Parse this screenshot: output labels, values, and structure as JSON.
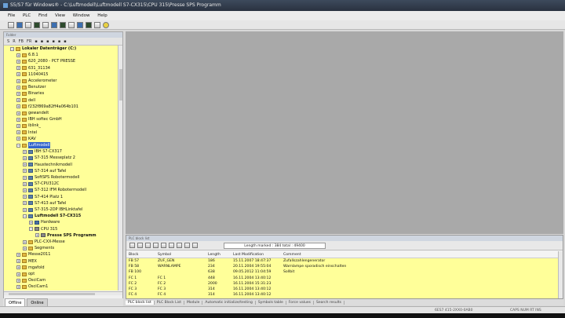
{
  "window": {
    "title": "S5/S7 für Windows® - C:\\Luftmodell\\Luftmodell S7-CX315\\CPU 315\\Presse SPS Programm"
  },
  "menu": [
    "File",
    "PLC",
    "Find",
    "View",
    "Window",
    "Help"
  ],
  "tree": {
    "caption": "Folder",
    "toolbar": [
      "S",
      "R",
      "FB",
      "FR",
      "",
      "",
      "",
      "",
      "",
      "",
      ""
    ],
    "nodes": [
      {
        "label": "Lokaler Datenträger (C:)",
        "bold": true
      },
      {
        "label": "6.8.1"
      },
      {
        "label": "620_2080 - PCT PRESSE"
      },
      {
        "label": "631_31134"
      },
      {
        "label": "11040415"
      },
      {
        "label": "Accelerometer"
      },
      {
        "label": "Benutzer"
      },
      {
        "label": "Binaries"
      },
      {
        "label": "dell"
      },
      {
        "label": "f232f869a82ff4a064b101"
      },
      {
        "label": "gewandelt"
      },
      {
        "label": "IBH softec GmbH"
      },
      {
        "label": "iblink_"
      },
      {
        "label": "Intel"
      },
      {
        "label": "KAV"
      },
      {
        "label": "Luftmodell",
        "selected": true
      },
      {
        "label": "IBH S7-CX317"
      },
      {
        "label": "S7-315 Messeplatz 2"
      },
      {
        "label": "Haustechnikmodell"
      },
      {
        "label": "S7-314 auf Tafel"
      },
      {
        "label": "SoftSPS Robotermodell"
      },
      {
        "label": "S7-CPU312C"
      },
      {
        "label": "S7-312 IFM Robotermodell"
      },
      {
        "label": "S7-414 Platz 1"
      },
      {
        "label": "S7-413 auf Tafel"
      },
      {
        "label": "S7-315-2DP IBHLinktafel"
      },
      {
        "label": "Luftmodell S7-CX315",
        "bold": true
      },
      {
        "label": "Hardware"
      },
      {
        "label": "CPU 315"
      },
      {
        "label": "Presse SPS Programm",
        "bold": true
      },
      {
        "label": "PLC-CXX-Messe"
      },
      {
        "label": "Segments"
      },
      {
        "label": "Messe2011"
      },
      {
        "label": "MEX"
      },
      {
        "label": "mgafold"
      },
      {
        "label": "opt"
      },
      {
        "label": "OsciCam"
      },
      {
        "label": "OsciCam1"
      }
    ]
  },
  "left_tabs": [
    "Offline",
    "Online"
  ],
  "block_list": {
    "caption": "PLC block list",
    "length_marked": "Length marked : 384 total : 49400",
    "columns": [
      "Block",
      "Symbol",
      "Length",
      "Last Modification",
      "Comment"
    ],
    "rows": [
      [
        "FB 57",
        "ZUF_GEN",
        "186",
        "15.11.2007 18:47:37",
        "Zufallszahlengenerator"
      ],
      [
        "FB 58",
        "WARNLAMPE",
        "234",
        "20.11.2004 19:55:04",
        "Warnlampe sporadisch einschalten"
      ],
      [
        "FB 100",
        "",
        "638",
        "09.05.2012 11:04:59",
        "Sollbit"
      ],
      [
        "FC 1",
        "FC 1",
        "448",
        "16.11.2004 13:40:12",
        ""
      ],
      [
        "FC 2",
        "FC 2",
        "2000",
        "16.11.2004 15:31:23",
        ""
      ],
      [
        "FC 3",
        "FC 3",
        "314",
        "16.11.2004 13:40:12",
        ""
      ],
      [
        "FC 4",
        "FC 4",
        "314",
        "16.11.2004 13:40:12",
        ""
      ]
    ]
  },
  "bottom_tabs": [
    "PLC block list",
    "PLC Block List",
    "Module",
    "Automatic initialize/testing",
    "Symbols table",
    "Force values",
    "Search results"
  ],
  "status": {
    "left": "",
    "right": "6ES7 415-2XX0-0AB0",
    "mode": "CAPS NUM RT INS"
  }
}
